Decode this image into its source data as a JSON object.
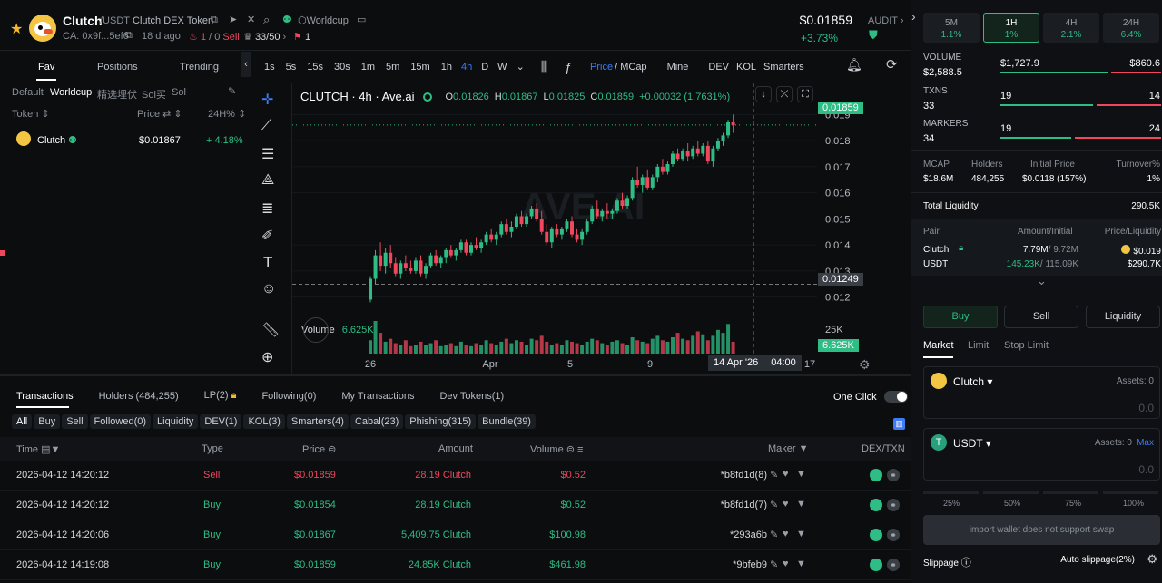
{
  "header": {
    "symbol": "Clutch",
    "quote": "/USDT",
    "token_name": "Clutch DEX Token",
    "worldcup_tag": "Worldcup",
    "ca": "CA: 0x9f...5ef6",
    "age": "18 d ago",
    "sell_counter_a": "1",
    "sell_counter_b": "/ 0",
    "sell_label": "Sell",
    "holders_ratio": "33/50",
    "flag_count": "1",
    "price": "$0.01859",
    "change": "+3.73%",
    "audit": "AUDIT"
  },
  "left_panel": {
    "tabs": [
      "Fav",
      "Positions",
      "Trending"
    ],
    "filters": [
      "Default",
      "Worldcup",
      "精选埋伏",
      "Sol买",
      "Sol"
    ],
    "columns": [
      "Token",
      "Price",
      "24H%"
    ],
    "items": [
      {
        "name": "Clutch",
        "price": "$0.01867",
        "change": "+ 4.18%"
      }
    ]
  },
  "chart_toolbar": {
    "timeframes": [
      "1s",
      "5s",
      "15s",
      "30s",
      "1m",
      "5m",
      "15m",
      "1h",
      "4h",
      "D",
      "W"
    ],
    "active_timeframe": "4h",
    "price_label": "Price",
    "mcap_label": "/ MCap",
    "mine": "Mine",
    "dev": "DEV",
    "kol": "KOL",
    "smarters": "Smarters"
  },
  "chart_legend": {
    "title": "CLUTCH · 4h · Ave.ai",
    "o_label": "O",
    "o": "0.01826",
    "h_label": "H",
    "h": "0.01867",
    "l_label": "L",
    "l": "0.01825",
    "c_label": "C",
    "c": "0.01859",
    "delta": "+0.00032 (1.7631%)",
    "volume_label": "Volume",
    "volume_value": "6.625K",
    "watermark": "AVE.AI",
    "crosshair_date": "14 Apr '26",
    "crosshair_time": "04:00",
    "last_price_tag": "0.01859",
    "cross_price_tag": "0.01249",
    "vol_tag": "6.625K"
  },
  "chart_data": {
    "type": "candlestick",
    "ylim": [
      0.0115,
      0.0195
    ],
    "yticks": [
      "0.019",
      "0.018",
      "0.017",
      "0.016",
      "0.015",
      "0.014",
      "0.013",
      "0.012"
    ],
    "volume_tick": "25K",
    "xticks": [
      "26",
      "Apr",
      "5",
      "9",
      "17"
    ],
    "candles": [
      [
        0.0119,
        0.0128,
        0.0118,
        0.0127
      ],
      [
        0.0127,
        0.0138,
        0.0125,
        0.0136
      ],
      [
        0.0136,
        0.0141,
        0.013,
        0.0132
      ],
      [
        0.0132,
        0.0139,
        0.0129,
        0.0137
      ],
      [
        0.0137,
        0.014,
        0.0131,
        0.0133
      ],
      [
        0.0133,
        0.0135,
        0.0128,
        0.0129
      ],
      [
        0.0129,
        0.0134,
        0.0127,
        0.0133
      ],
      [
        0.0133,
        0.0136,
        0.013,
        0.0131
      ],
      [
        0.0131,
        0.0134,
        0.0129,
        0.013
      ],
      [
        0.013,
        0.0135,
        0.0129,
        0.0134
      ],
      [
        0.0134,
        0.0136,
        0.0128,
        0.0129
      ],
      [
        0.0129,
        0.0133,
        0.0127,
        0.0132
      ],
      [
        0.0132,
        0.0137,
        0.0131,
        0.0136
      ],
      [
        0.0136,
        0.0138,
        0.0132,
        0.0133
      ],
      [
        0.0133,
        0.0136,
        0.0131,
        0.0135
      ],
      [
        0.0135,
        0.0139,
        0.0133,
        0.0138
      ],
      [
        0.0138,
        0.014,
        0.0135,
        0.0136
      ],
      [
        0.0136,
        0.0139,
        0.0134,
        0.0138
      ],
      [
        0.0138,
        0.0142,
        0.0137,
        0.0141
      ],
      [
        0.0141,
        0.0142,
        0.0136,
        0.0137
      ],
      [
        0.0137,
        0.0141,
        0.0136,
        0.014
      ],
      [
        0.014,
        0.0143,
        0.0138,
        0.0139
      ],
      [
        0.0139,
        0.0142,
        0.0137,
        0.0141
      ],
      [
        0.0141,
        0.0145,
        0.014,
        0.0144
      ],
      [
        0.0144,
        0.0146,
        0.0141,
        0.0142
      ],
      [
        0.0142,
        0.0145,
        0.014,
        0.0144
      ],
      [
        0.0144,
        0.0149,
        0.0143,
        0.0148
      ],
      [
        0.0148,
        0.015,
        0.0144,
        0.0145
      ],
      [
        0.0145,
        0.0149,
        0.0143,
        0.0147
      ],
      [
        0.0147,
        0.0152,
        0.0146,
        0.0151
      ],
      [
        0.0151,
        0.0153,
        0.0147,
        0.0148
      ],
      [
        0.0148,
        0.0152,
        0.0147,
        0.0151
      ],
      [
        0.0151,
        0.0155,
        0.015,
        0.0154
      ],
      [
        0.0154,
        0.0156,
        0.0149,
        0.015
      ],
      [
        0.015,
        0.0153,
        0.0144,
        0.0145
      ],
      [
        0.0145,
        0.0148,
        0.014,
        0.0141
      ],
      [
        0.0141,
        0.0147,
        0.0139,
        0.0146
      ],
      [
        0.0146,
        0.0148,
        0.0143,
        0.0144
      ],
      [
        0.0144,
        0.0147,
        0.0142,
        0.0146
      ],
      [
        0.0146,
        0.015,
        0.0145,
        0.0149
      ],
      [
        0.0149,
        0.0151,
        0.0143,
        0.0144
      ],
      [
        0.0144,
        0.0146,
        0.0141,
        0.0142
      ],
      [
        0.0142,
        0.0146,
        0.014,
        0.0145
      ],
      [
        0.0145,
        0.015,
        0.0144,
        0.0149
      ],
      [
        0.0149,
        0.0155,
        0.0148,
        0.0154
      ],
      [
        0.0154,
        0.0157,
        0.015,
        0.0151
      ],
      [
        0.0151,
        0.0154,
        0.0149,
        0.0153
      ],
      [
        0.0153,
        0.0156,
        0.015,
        0.0152
      ],
      [
        0.0152,
        0.0154,
        0.015,
        0.0153
      ],
      [
        0.0153,
        0.0158,
        0.0152,
        0.0157
      ],
      [
        0.0157,
        0.016,
        0.0154,
        0.0155
      ],
      [
        0.0155,
        0.0159,
        0.0154,
        0.0158
      ],
      [
        0.0158,
        0.0166,
        0.0157,
        0.0165
      ],
      [
        0.0165,
        0.017,
        0.0162,
        0.0163
      ],
      [
        0.0163,
        0.0167,
        0.016,
        0.0166
      ],
      [
        0.0166,
        0.0169,
        0.0161,
        0.0162
      ],
      [
        0.0162,
        0.0167,
        0.0161,
        0.0166
      ],
      [
        0.0166,
        0.0171,
        0.0164,
        0.017
      ],
      [
        0.017,
        0.0173,
        0.0167,
        0.0168
      ],
      [
        0.0168,
        0.0172,
        0.0167,
        0.0171
      ],
      [
        0.0171,
        0.0176,
        0.017,
        0.0175
      ],
      [
        0.0175,
        0.0177,
        0.0172,
        0.0173
      ],
      [
        0.0173,
        0.0177,
        0.0172,
        0.0176
      ],
      [
        0.0176,
        0.0179,
        0.0172,
        0.0174
      ],
      [
        0.0174,
        0.0178,
        0.0173,
        0.0177
      ],
      [
        0.0177,
        0.018,
        0.0174,
        0.0175
      ],
      [
        0.0175,
        0.0179,
        0.0174,
        0.0178
      ],
      [
        0.0178,
        0.018,
        0.0171,
        0.0172
      ],
      [
        0.0172,
        0.0178,
        0.017,
        0.0177
      ],
      [
        0.0177,
        0.0181,
        0.0176,
        0.018
      ],
      [
        0.018,
        0.0183,
        0.0178,
        0.0182
      ],
      [
        0.0182,
        0.0188,
        0.0181,
        0.0187
      ],
      [
        0.0187,
        0.019,
        0.0183,
        0.0186
      ]
    ],
    "volumes": [
      9,
      22,
      14,
      8,
      10,
      7,
      6,
      9,
      5,
      6,
      8,
      6,
      7,
      9,
      5,
      6,
      7,
      5,
      8,
      6,
      5,
      7,
      6,
      9,
      7,
      6,
      8,
      10,
      7,
      9,
      8,
      6,
      10,
      9,
      12,
      8,
      6,
      7,
      6,
      9,
      8,
      7,
      6,
      8,
      10,
      9,
      7,
      6,
      8,
      9,
      7,
      6,
      11,
      9,
      8,
      7,
      10,
      12,
      9,
      8,
      11,
      14,
      10,
      9,
      12,
      15,
      13,
      9,
      12,
      16,
      14,
      20,
      8
    ]
  },
  "tabs_bottom": {
    "items": [
      "Transactions",
      "Holders (484,255)",
      "LP(2)",
      "Following(0)",
      "My Transactions",
      "Dev Tokens(1)"
    ],
    "one_click": "One Click",
    "filters": [
      "All",
      "Buy",
      "Sell",
      "Followed(0)",
      "Liquidity",
      "DEV(1)",
      "KOL(3)",
      "Smarters(4)",
      "Cabal(23)",
      "Phishing(315)",
      "Bundle(39)"
    ]
  },
  "table": {
    "headers": [
      "Time",
      "Type",
      "Price",
      "Amount",
      "Volume",
      "Maker",
      "DEX/TXN"
    ],
    "rows": [
      {
        "time": "2026-04-12 14:20:12",
        "type": "Sell",
        "price": "$0.01859",
        "amount": "28.19 Clutch",
        "volume": "$0.52",
        "maker": "*b8fd1d(8)"
      },
      {
        "time": "2026-04-12 14:20:12",
        "type": "Buy",
        "price": "$0.01854",
        "amount": "28.19 Clutch",
        "volume": "$0.52",
        "maker": "*b8fd1d(7)"
      },
      {
        "time": "2026-04-12 14:20:06",
        "type": "Buy",
        "price": "$0.01867",
        "amount": "5,409.75 Clutch",
        "volume": "$100.98",
        "maker": "*293a6b"
      },
      {
        "time": "2026-04-12 14:19:08",
        "type": "Buy",
        "price": "$0.01859",
        "amount": "24.85K Clutch",
        "volume": "$461.98",
        "maker": "*9bfeb9"
      }
    ]
  },
  "right_panel": {
    "periods": [
      {
        "label": "5M",
        "value": "1.1%"
      },
      {
        "label": "1H",
        "value": "1%"
      },
      {
        "label": "4H",
        "value": "2.1%"
      },
      {
        "label": "24H",
        "value": "6.4%"
      }
    ],
    "active_period": "1H",
    "volume_label": "VOLUME",
    "volume": "$2,588.5",
    "volume_buy": "$1,727.9",
    "volume_sell": "$860.6",
    "txns_label": "TXNS",
    "txns": "33",
    "txns_buy": "19",
    "txns_sell": "14",
    "makers_label": "MARKERS",
    "makers": "34",
    "makers_buy": "19",
    "makers_sell": "24",
    "stats_labels": [
      "MCAP",
      "Holders",
      "Initial Price",
      "Turnover%"
    ],
    "stats_values": [
      "$18.6M",
      "484,255",
      "$0.0118 (157%)",
      "1%"
    ],
    "total_liquidity_label": "Total Liquidity",
    "total_liquidity": "290.5K",
    "pair_headers": [
      "Pair",
      "Amount/Initial",
      "Price/Liquidity"
    ],
    "pair_rows": [
      {
        "name": "Clutch",
        "amount": "7.79M",
        "initial": "/ 9.72M",
        "price": "$0.019"
      },
      {
        "name": "USDT",
        "amount": "145.23K",
        "initial": "/ 115.09K",
        "price": "$290.7K"
      }
    ],
    "trade_tabs": [
      "Buy",
      "Sell",
      "Liquidity"
    ],
    "order_types": [
      "Market",
      "Limit",
      "Stop Limit"
    ],
    "from_token": "Clutch",
    "from_assets": "Assets: 0",
    "from_amount": "0.0",
    "to_token": "USDT",
    "to_assets": "Assets: 0",
    "max": "Max",
    "to_amount": "0.0",
    "percents": [
      "25%",
      "50%",
      "75%",
      "100%"
    ],
    "import_button": "import wallet does not support swap",
    "slippage_label": "Slippage",
    "slippage_value": "Auto slippage(2%)"
  },
  "colors": {
    "up": "#2ebd85",
    "down": "#f0475c",
    "accent": "#2ebd85",
    "link": "#3d7bf7"
  }
}
